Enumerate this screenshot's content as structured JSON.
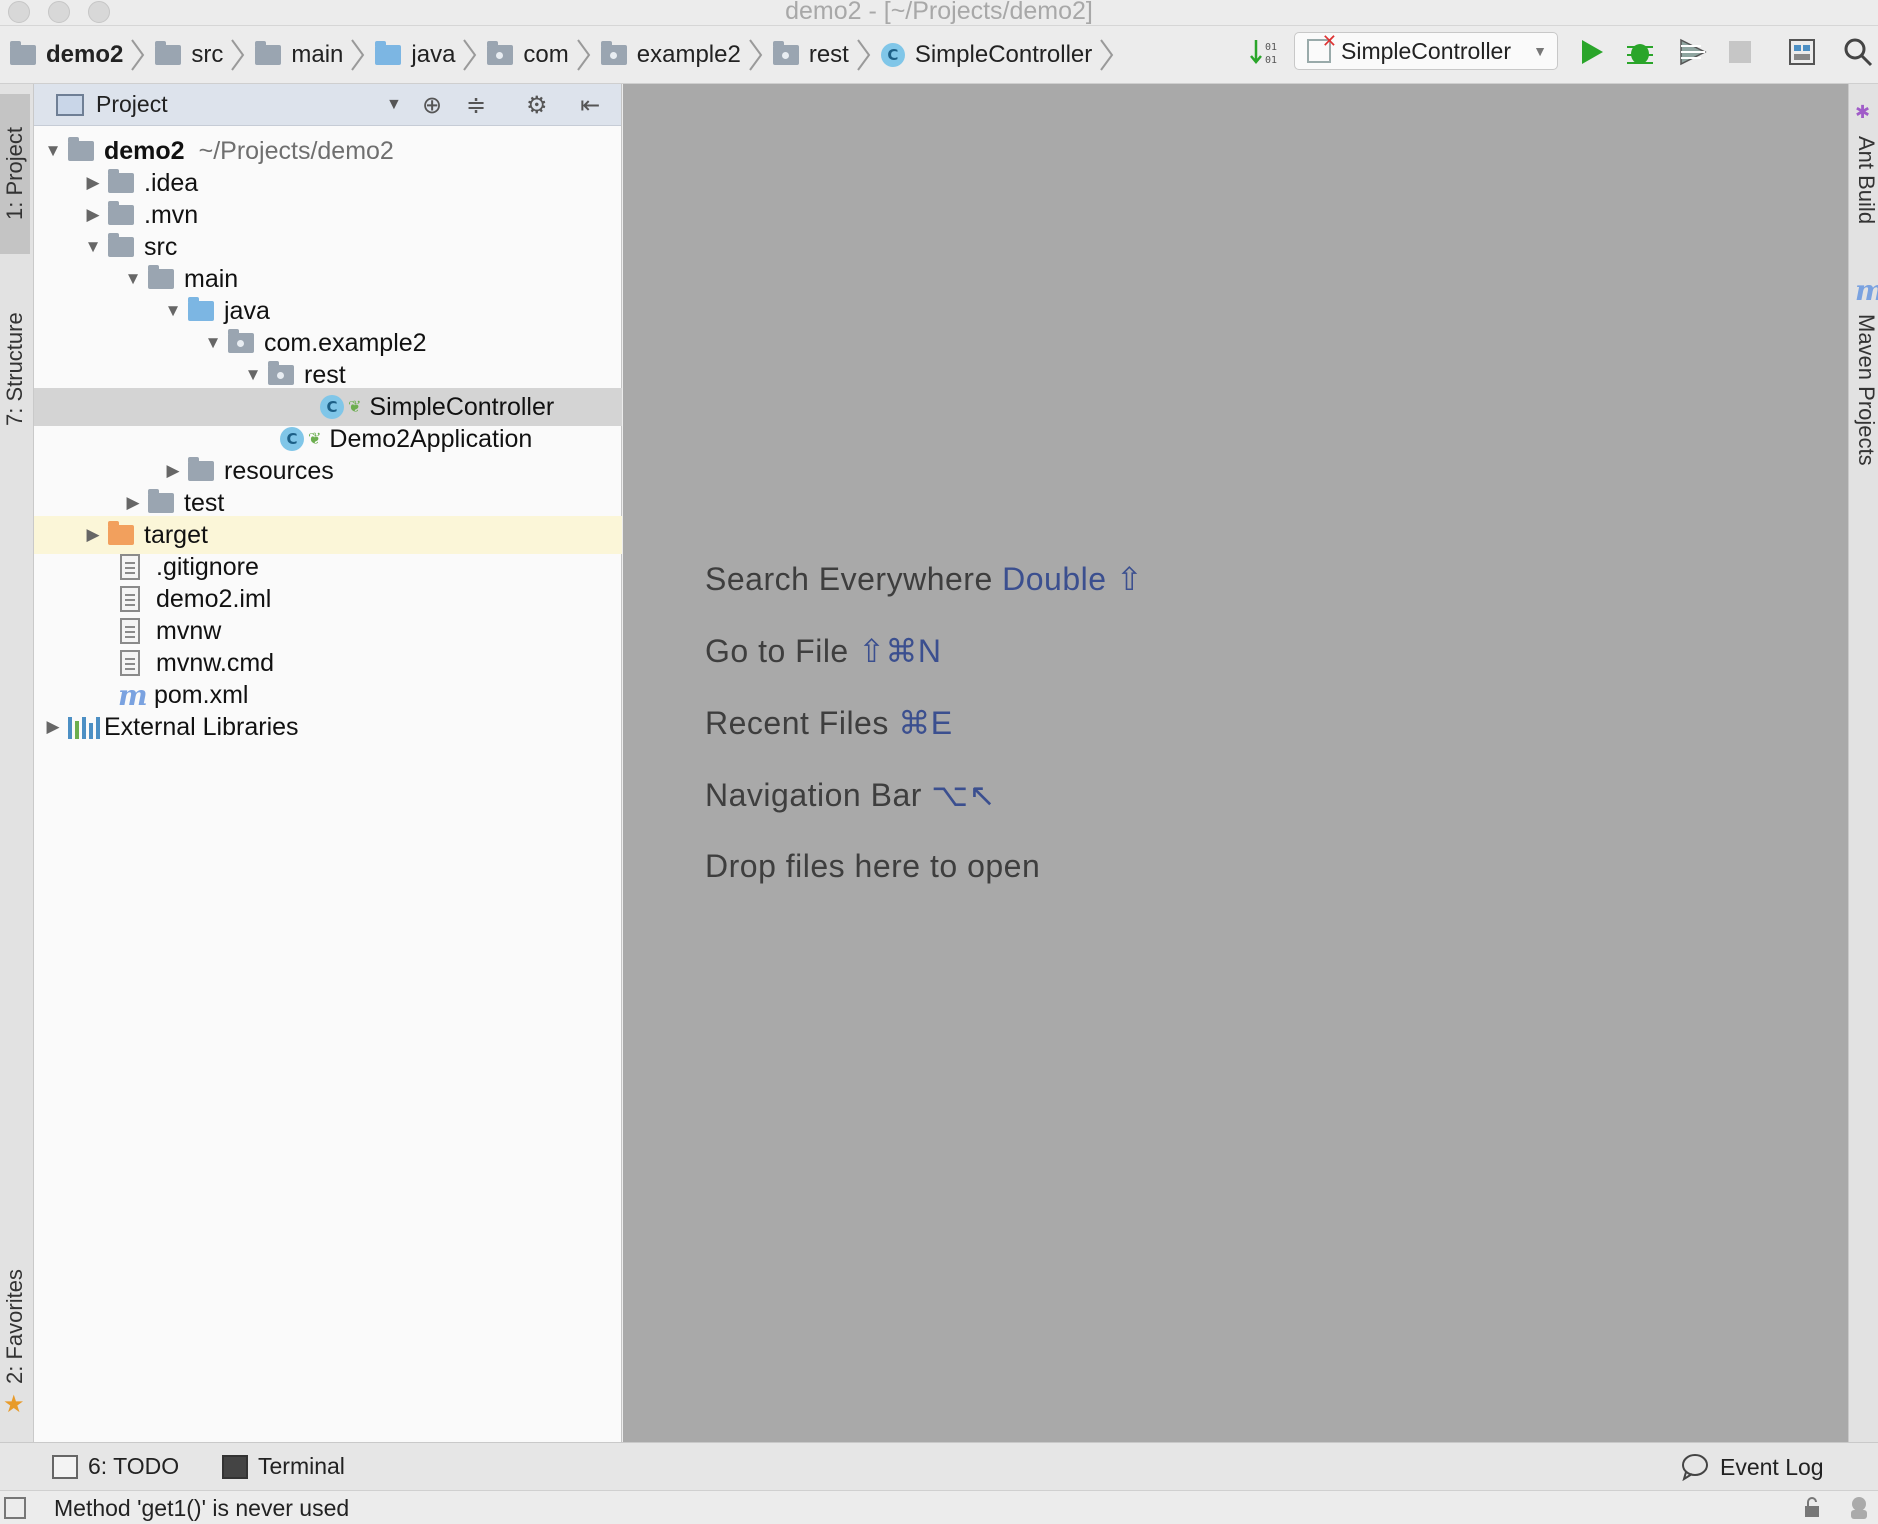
{
  "window": {
    "title": "demo2 - [~/Projects/demo2]"
  },
  "navbar": {
    "breadcrumbs": [
      {
        "label": "demo2",
        "icon": "module-folder-icon"
      },
      {
        "label": "src",
        "icon": "folder-icon"
      },
      {
        "label": "main",
        "icon": "folder-icon"
      },
      {
        "label": "java",
        "icon": "source-folder-icon"
      },
      {
        "label": "com",
        "icon": "package-icon"
      },
      {
        "label": "example2",
        "icon": "package-icon"
      },
      {
        "label": "rest",
        "icon": "package-icon"
      },
      {
        "label": "SimpleController",
        "icon": "class-icon"
      }
    ],
    "run_config": "SimpleController",
    "class_icon_letter": "C"
  },
  "left_tabs": {
    "project": "1: Project",
    "structure": "7: Structure",
    "favorites": "2: Favorites"
  },
  "right_tabs": {
    "ant": "Ant Build",
    "maven": "Maven Projects"
  },
  "project_panel": {
    "title": "Project",
    "tree": [
      {
        "name": "demo2",
        "path": "~/Projects/demo2"
      },
      {
        "name": ".idea"
      },
      {
        "name": ".mvn"
      },
      {
        "name": "src"
      },
      {
        "name": "main"
      },
      {
        "name": "java"
      },
      {
        "name": "com.example2"
      },
      {
        "name": "rest"
      },
      {
        "name": "SimpleController"
      },
      {
        "name": "Demo2Application"
      },
      {
        "name": "resources"
      },
      {
        "name": "test"
      },
      {
        "name": "target"
      },
      {
        "name": ".gitignore"
      },
      {
        "name": "demo2.iml"
      },
      {
        "name": "mvnw"
      },
      {
        "name": "mvnw.cmd"
      },
      {
        "name": "pom.xml"
      },
      {
        "name": "External Libraries"
      }
    ]
  },
  "editor_hints": [
    {
      "label": "Search Everywhere",
      "key": "Double ⇧"
    },
    {
      "label": "Go to File",
      "key": "⇧⌘N"
    },
    {
      "label": "Recent Files",
      "key": "⌘E"
    },
    {
      "label": "Navigation Bar",
      "key": "⌥↖"
    },
    {
      "label": "Drop files here to open",
      "key": ""
    }
  ],
  "bottom_tools": {
    "todo": "6: TODO",
    "terminal": "Terminal",
    "event_log": "Event Log"
  },
  "status": {
    "message": "Method 'get1()' is never used"
  },
  "colors": {
    "editor_bg": "#a9a9a9",
    "shortcut": "#3b4f8f",
    "selection": "#d4d4d4",
    "excluded": "#fbf6d8",
    "run_green": "#2aa52a"
  }
}
